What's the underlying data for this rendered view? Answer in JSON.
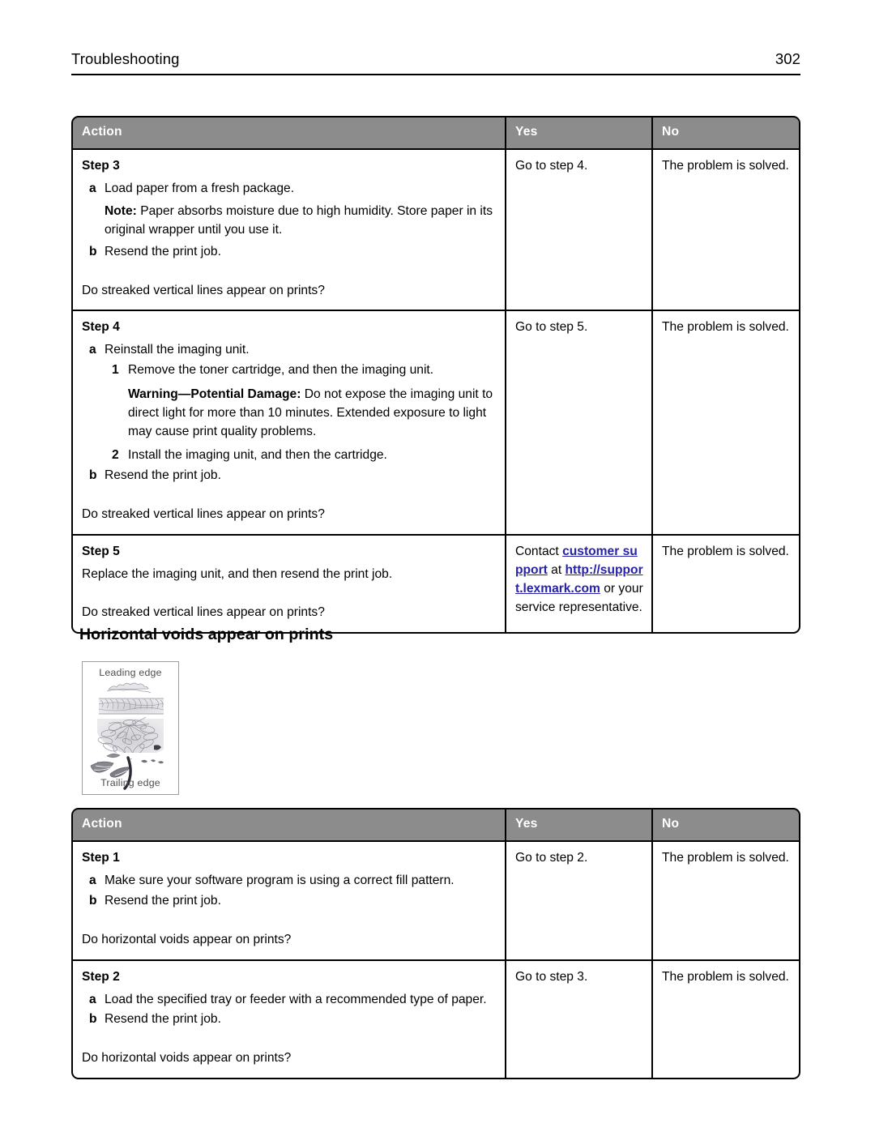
{
  "header": {
    "section": "Troubleshooting",
    "page_number": "302"
  },
  "tables": {
    "streaked_vertical_lines": {
      "columns": {
        "action": "Action",
        "yes": "Yes",
        "no": "No"
      },
      "rows": [
        {
          "step_title": "Step 3",
          "items": [
            {
              "marker": "a",
              "text": "Load paper from a fresh package."
            }
          ],
          "note_lead": "Note:",
          "note_text": " Paper absorbs moisture due to high humidity. Store paper in its original wrapper until you use it.",
          "items2": [
            {
              "marker": "b",
              "text": "Resend the print job."
            }
          ],
          "question": "Do streaked vertical lines appear on prints?",
          "yes": "Go to step 4.",
          "no": "The problem is solved."
        },
        {
          "step_title": "Step 4",
          "items": [
            {
              "marker": "a",
              "text": "Reinstall the imaging unit."
            }
          ],
          "sub_items": [
            {
              "marker": "1",
              "text": "Remove the toner cartridge, and then the imaging unit."
            }
          ],
          "warn_lead": "Warning—Potential Damage:",
          "warn_text": " Do not expose the imaging unit to direct light for more than 10 minutes. Extended exposure to light may cause print quality problems.",
          "sub_items2": [
            {
              "marker": "2",
              "text": "Install the imaging unit, and then the cartridge."
            }
          ],
          "items2": [
            {
              "marker": "b",
              "text": "Resend the print job."
            }
          ],
          "question": "Do streaked vertical lines appear on prints?",
          "yes": "Go to step 5.",
          "no": "The problem is solved."
        },
        {
          "step_title": "Step 5",
          "body": "Replace the imaging unit, and then resend the print job.",
          "question": "Do streaked vertical lines appear on prints?",
          "yes_parts": {
            "before": "Contact ",
            "link1": "customer support",
            "middle": " at ",
            "link2": "http://support.lexmark.com",
            "after": " or your service representative."
          },
          "no": "The problem is solved."
        }
      ]
    },
    "horizontal_voids": {
      "columns": {
        "action": "Action",
        "yes": "Yes",
        "no": "No"
      },
      "rows": [
        {
          "step_title": "Step 1",
          "items": [
            {
              "marker": "a",
              "text": "Make sure your software program is using a correct fill pattern."
            },
            {
              "marker": "b",
              "text": "Resend the print job."
            }
          ],
          "question": "Do horizontal voids appear on prints?",
          "yes": "Go to step 2.",
          "no": "The problem is solved."
        },
        {
          "step_title": "Step 2",
          "items": [
            {
              "marker": "a",
              "text": "Load the specified tray or feeder with a recommended type of paper."
            },
            {
              "marker": "b",
              "text": "Resend the print job."
            }
          ],
          "question": "Do horizontal voids appear on prints?",
          "yes": "Go to step 3.",
          "no": "The problem is solved."
        }
      ]
    }
  },
  "section_heading": "Horizontal voids appear on prints",
  "figure": {
    "top_label": "Leading edge",
    "bottom_label": "Trailing edge"
  },
  "colors": {
    "table_header_bg": "#8c8c8c",
    "table_header_text": "#ffffff",
    "link": "#2623a8",
    "border": "#000000"
  }
}
